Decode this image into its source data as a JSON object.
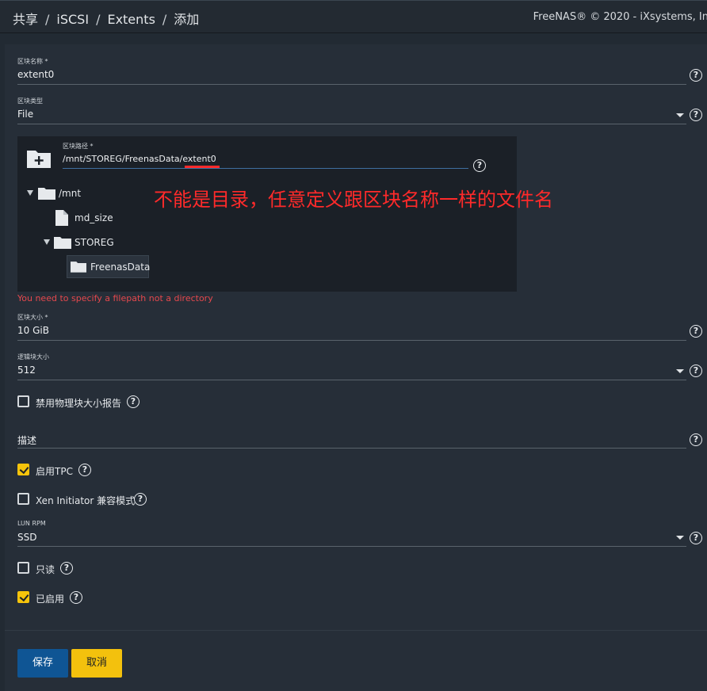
{
  "breadcrumb": {
    "items": [
      "共享",
      "iSCSI",
      "Extents",
      "添加"
    ],
    "separator": "/"
  },
  "copyright": "FreeNAS® © 2020 - iXsystems, In",
  "form": {
    "extent_name": {
      "label": "区块名称 *",
      "value": "extent0"
    },
    "extent_type": {
      "label": "区块类型",
      "value": "File"
    },
    "extent_path": {
      "label": "区块路径 *",
      "value": "/mnt/STOREG/FreenasData/extent0"
    },
    "tree": {
      "root": "/mnt",
      "file": "md_size",
      "folder": "STOREG",
      "selected": "FreenasData"
    },
    "path_error": "You need to specify a filepath not a directory",
    "extent_size": {
      "label": "区块大小 *",
      "value": "10 GiB"
    },
    "logical_block_size": {
      "label": "逻辑块大小",
      "value": "512"
    },
    "disable_pblocksize": {
      "label": "禁用物理块大小报告",
      "checked": false
    },
    "description": {
      "value": "描述"
    },
    "enable_tpc": {
      "label": "启用TPC",
      "checked": true
    },
    "xen_compat": {
      "label": "Xen Initiator 兼容模式",
      "checked": false
    },
    "lun_rpm": {
      "label": "LUN RPM",
      "value": "SSD"
    },
    "read_only": {
      "label": "只读",
      "checked": false
    },
    "enabled": {
      "label": "已启用",
      "checked": true
    }
  },
  "annotation": "不能是目录，任意定义跟区块名称一样的文件名",
  "buttons": {
    "save": "保存",
    "cancel": "取消"
  },
  "colors": {
    "background": "#222a33",
    "card": "#262e38",
    "accent_yellow": "#f3c10d",
    "primary_blue": "#0f5594",
    "error_red": "#e5484d",
    "annotation_red": "#ff2a2a"
  },
  "icons": {
    "help": "question-circle-icon",
    "dropdown": "caret-down-icon",
    "new_folder": "folder-plus-icon",
    "folder": "folder-icon",
    "file": "file-icon",
    "expand": "triangle-down-icon"
  }
}
